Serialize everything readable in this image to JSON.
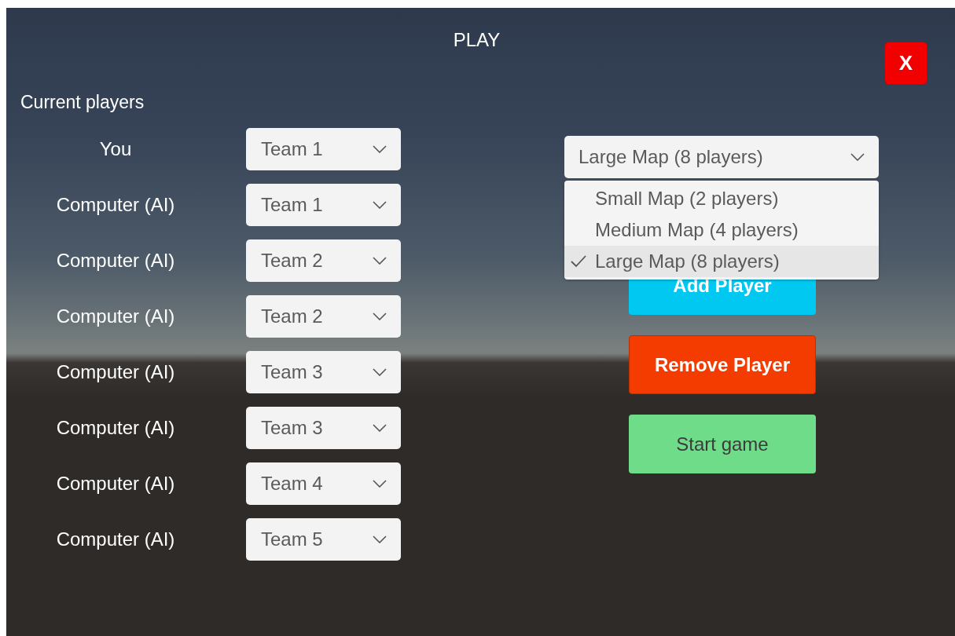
{
  "title": "PLAY",
  "close_button": {
    "label": "X"
  },
  "players_heading": "Current players",
  "players": [
    {
      "name": "You",
      "team": "Team 1"
    },
    {
      "name": "Computer (AI)",
      "team": "Team 1"
    },
    {
      "name": "Computer (AI)",
      "team": "Team 2"
    },
    {
      "name": "Computer (AI)",
      "team": "Team 2"
    },
    {
      "name": "Computer (AI)",
      "team": "Team 3"
    },
    {
      "name": "Computer (AI)",
      "team": "Team 3"
    },
    {
      "name": "Computer (AI)",
      "team": "Team 4"
    },
    {
      "name": "Computer (AI)",
      "team": "Team 5"
    }
  ],
  "map_select": {
    "value": "Large Map (8 players)",
    "expanded": true,
    "options": [
      {
        "label": "Small Map (2 players)",
        "selected": false
      },
      {
        "label": "Medium Map (4 players)",
        "selected": false
      },
      {
        "label": "Large Map (8 players)",
        "selected": true
      }
    ]
  },
  "buttons": [
    {
      "kind": "add",
      "label": "Add Player"
    },
    {
      "kind": "remove",
      "label": "Remove Player"
    },
    {
      "kind": "start",
      "label": "Start game"
    }
  ]
}
